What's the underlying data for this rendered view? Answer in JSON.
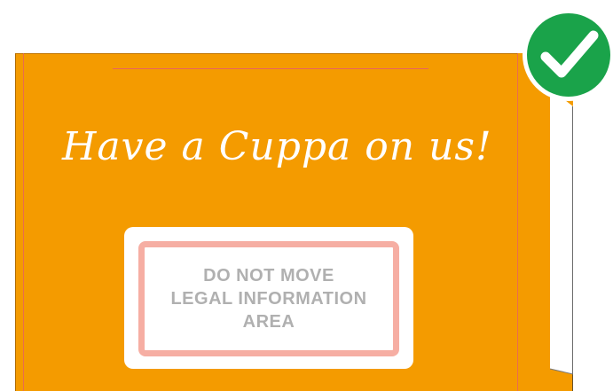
{
  "headline": "Have a Cuppa on us!",
  "legal_area": {
    "line1": "DO NOT MOVE",
    "line2": "LEGAL INFORMATION",
    "line3": "AREA"
  },
  "badge": {
    "icon": "checkmark-icon",
    "status": "approved"
  },
  "colors": {
    "card": "#f49b00",
    "bleed_guide": "#e65a6a",
    "legal_border": "#f6aea3",
    "legal_text": "#b0b0b0",
    "badge_fill": "#1aa34a"
  }
}
